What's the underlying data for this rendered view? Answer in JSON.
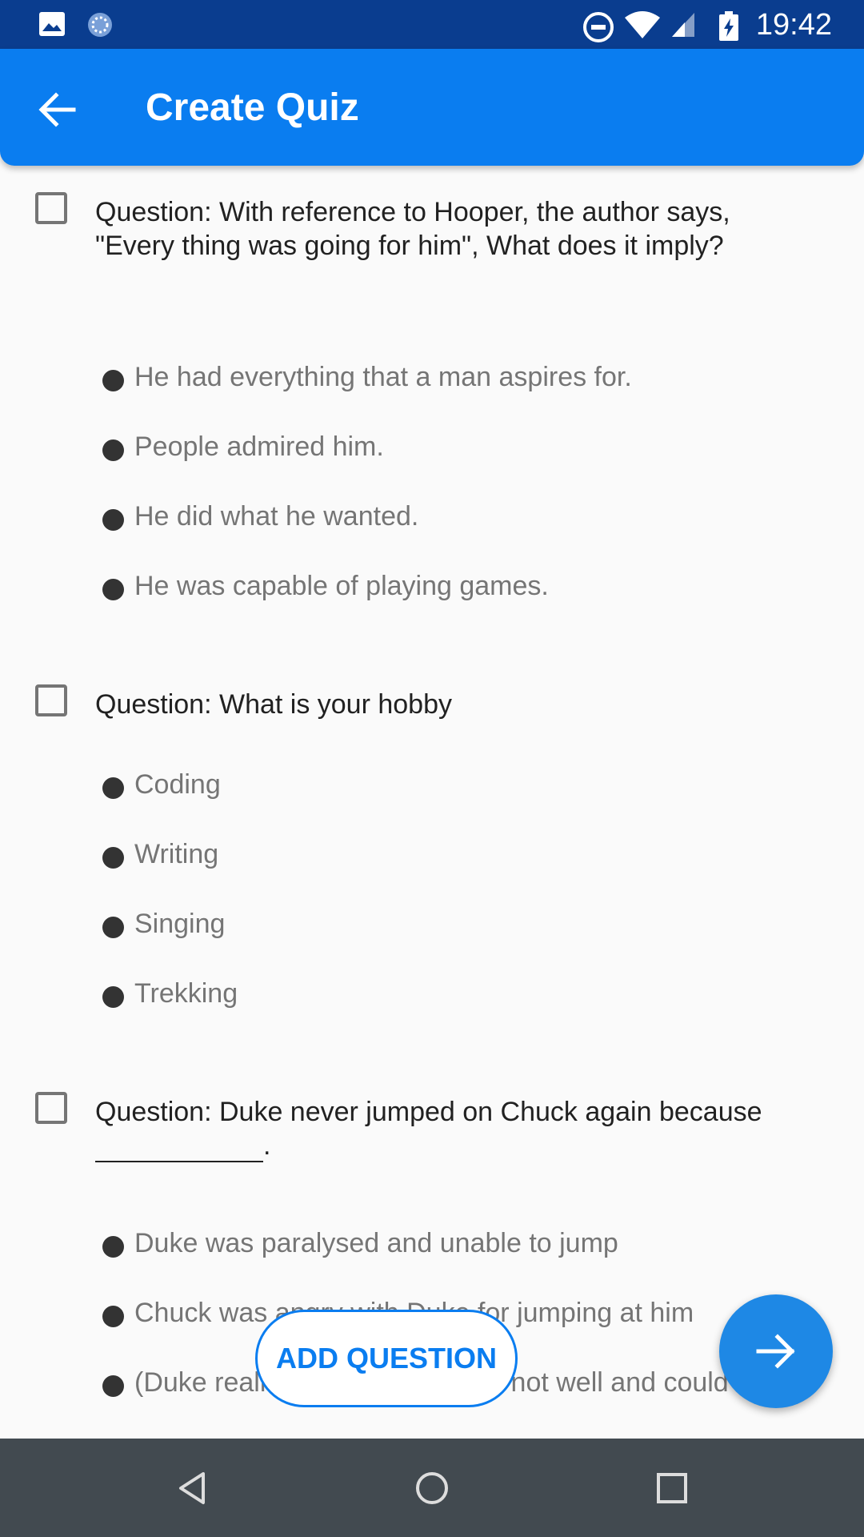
{
  "status_bar": {
    "time": "19:42",
    "icons": [
      "image-icon",
      "sync-icon",
      "do-not-disturb-icon",
      "wifi-icon",
      "signal-icon",
      "battery-charging-icon"
    ]
  },
  "app_bar": {
    "title": "Create Quiz",
    "back_icon": "arrow-left-icon"
  },
  "questions": [
    {
      "text_lines": [
        "Question: With reference to Hooper, the author says,",
        "\"Every thing was going for him\", What does it imply?"
      ],
      "options": [
        "He had everything that a man aspires for.",
        "People admired him.",
        "He did what he wanted.",
        "He was capable of playing games."
      ]
    },
    {
      "text_lines": [
        "Question: What is your hobby"
      ],
      "options": [
        "Coding",
        "Writing",
        "Singing",
        "Trekking"
      ]
    },
    {
      "text_lines": [
        "Question: Duke never jumped on Chuck again because",
        "."
      ],
      "options": [
        "Duke was paralysed and unable to jump",
        "Chuck was angry with Duke for jumping at him",
        "(Duke realised that Chuck was not well and could"
      ]
    }
  ],
  "add_question_label": "ADD QUESTION",
  "fab_icon": "arrow-right-icon",
  "nav_bar": [
    "back-triangle-icon",
    "home-circle-icon",
    "recents-square-icon"
  ],
  "colors": {
    "primary": "#0a7df0",
    "status_bar": "#0a3d8f",
    "nav_bar": "#424a50"
  }
}
